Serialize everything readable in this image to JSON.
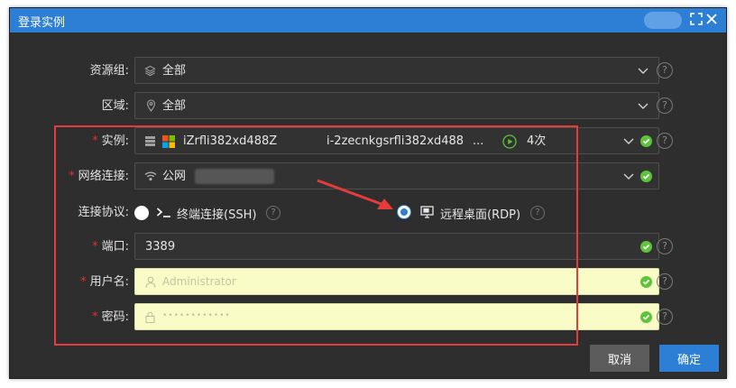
{
  "dialog": {
    "title": "登录实例"
  },
  "resource_group": {
    "label": "资源组:",
    "value": "全部"
  },
  "region": {
    "label": "区域:",
    "value": "全部"
  },
  "instance": {
    "label": "实例:",
    "name": "iZrfli382xd488Z",
    "id": "i-2zecnkgsrfli382xd488",
    "dots": "...",
    "count": "4次"
  },
  "network": {
    "label": "网络连接:",
    "value": "公网"
  },
  "protocol": {
    "label": "连接协议:",
    "option_ssh": "终端连接(SSH)",
    "option_rdp": "远程桌面(RDP)",
    "selected": "RDP"
  },
  "port": {
    "label": "端口:",
    "value": "3389"
  },
  "username": {
    "label": "用户名:",
    "placeholder": "Administrator"
  },
  "password": {
    "label": "密码:",
    "placeholder": "••••••••••••"
  },
  "buttons": {
    "cancel": "取消",
    "confirm": "确定"
  },
  "required_mark": "*",
  "help_glyph": "?",
  "colors": {
    "accent": "#2d7fd6",
    "success": "#5fc33c",
    "required": "#e23030",
    "annotation": "#e53b3b"
  },
  "icons": [
    "layers-icon",
    "location-pin-icon",
    "server-icon",
    "windows-icon",
    "play-circle-icon",
    "wifi-icon",
    "terminal-icon",
    "remote-desktop-icon",
    "user-icon",
    "lock-icon",
    "chevron-down-icon",
    "check-circle-icon",
    "help-icon",
    "maximize-icon",
    "close-icon"
  ]
}
